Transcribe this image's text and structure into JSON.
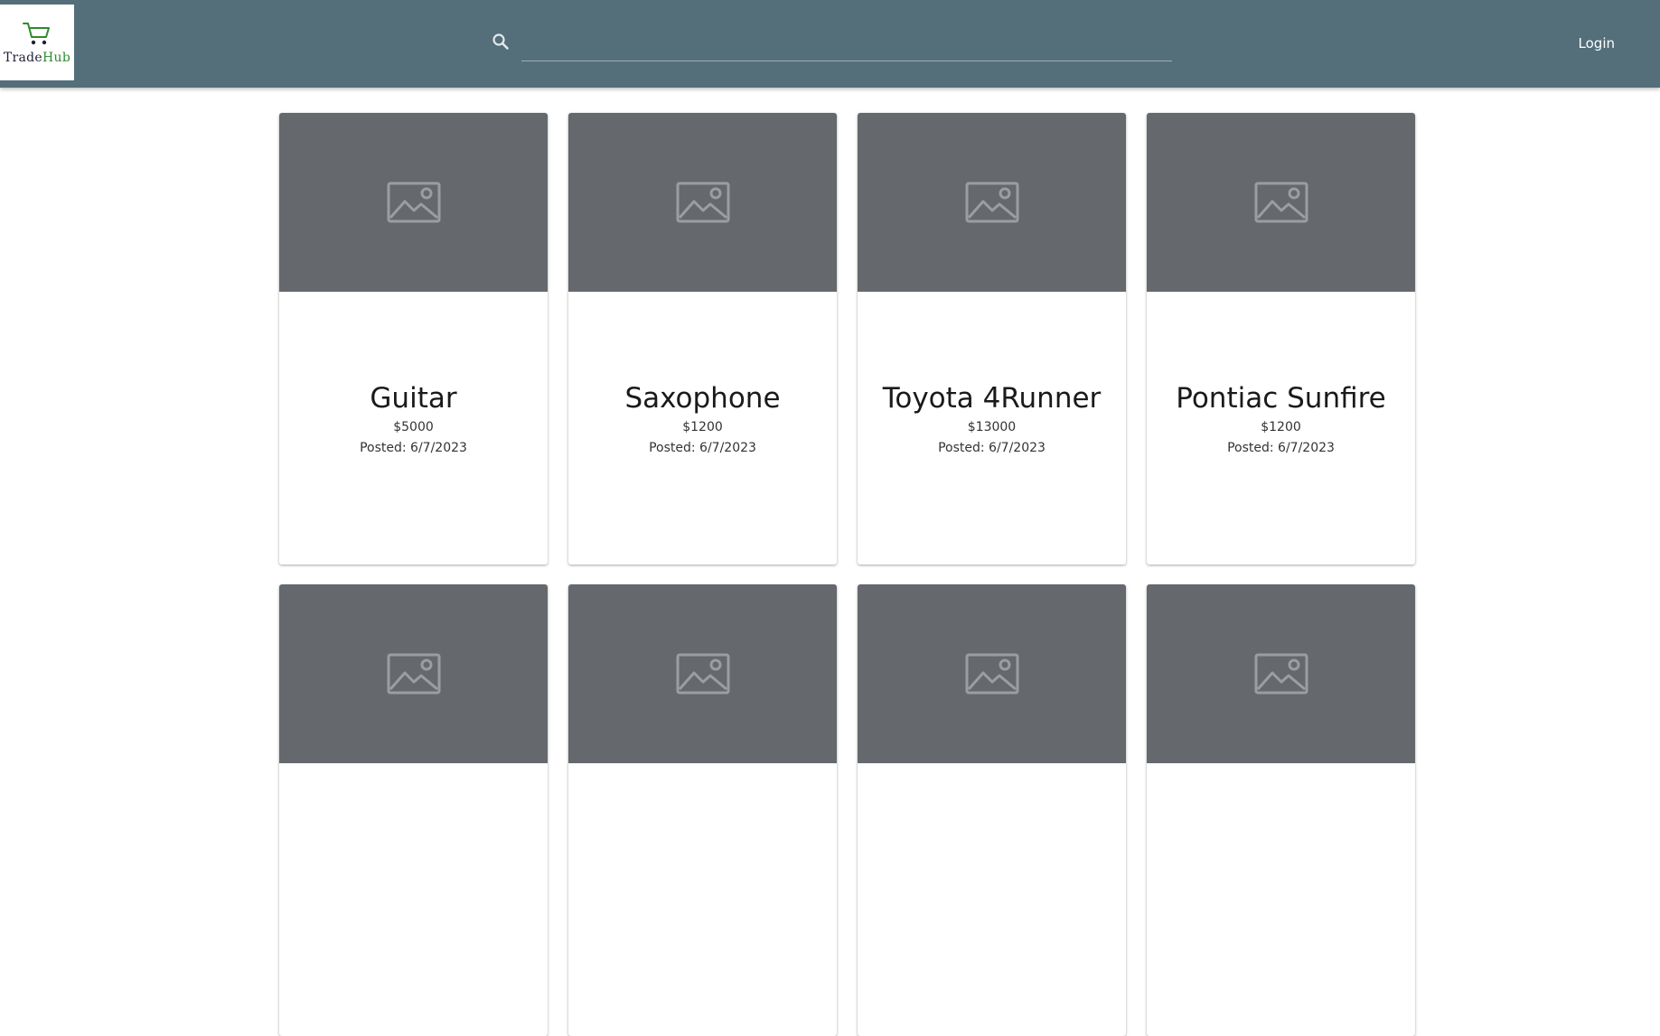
{
  "header": {
    "logo": {
      "text_main": "Trade",
      "text_accent": "Hub",
      "icon": "cart-icon"
    },
    "search": {
      "placeholder": "",
      "value": "",
      "icon": "search-icon"
    },
    "login_label": "Login",
    "colors": {
      "bar": "#546e7a",
      "logo_accent": "#2e8b2e"
    }
  },
  "listings": [
    {
      "title": "Guitar",
      "price": "$5000",
      "posted": "Posted: 6/7/2023",
      "image_icon": "image-placeholder-icon"
    },
    {
      "title": "Saxophone",
      "price": "$1200",
      "posted": "Posted: 6/7/2023",
      "image_icon": "image-placeholder-icon"
    },
    {
      "title": "Toyota 4Runner",
      "price": "$13000",
      "posted": "Posted: 6/7/2023",
      "image_icon": "image-placeholder-icon"
    },
    {
      "title": "Pontiac Sunfire",
      "price": "$1200",
      "posted": "Posted: 6/7/2023",
      "image_icon": "image-placeholder-icon"
    },
    {
      "title": "",
      "price": "",
      "posted": "",
      "image_icon": "image-placeholder-icon"
    },
    {
      "title": "",
      "price": "",
      "posted": "",
      "image_icon": "image-placeholder-icon"
    },
    {
      "title": "",
      "price": "",
      "posted": "",
      "image_icon": "image-placeholder-icon"
    },
    {
      "title": "",
      "price": "",
      "posted": "",
      "image_icon": "image-placeholder-icon"
    }
  ]
}
